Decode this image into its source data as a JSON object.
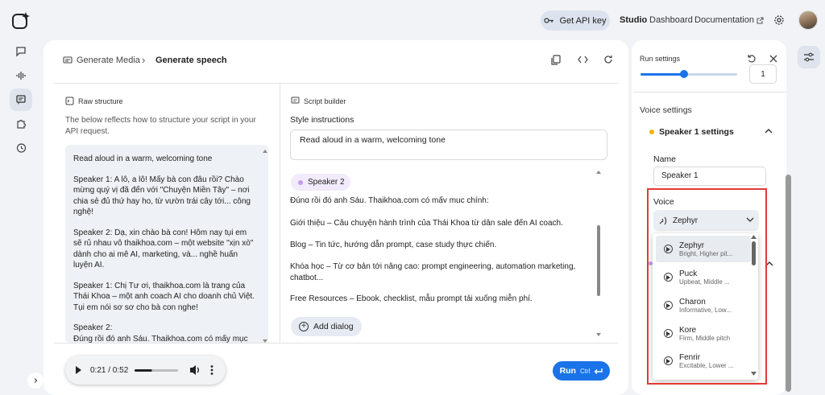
{
  "header": {
    "api_key_label": "Get API key",
    "nav_studio": "Studio",
    "nav_dashboard": "Dashboard",
    "nav_documentation": "Documentation"
  },
  "breadcrumb": {
    "parent": "Generate Media",
    "current": "Generate speech"
  },
  "raw_structure": {
    "title": "Raw structure",
    "description": "The below reflects how to structure your script in your API request.",
    "blocks": [
      "Read aloud in a warm, welcoming tone",
      "Speaker 1: A lô, a lô! Mấy bà con đâu rồi? Chào mừng quý vị đã đến với \"Chuyện Miền Tây\" – nơi chia sẻ đủ thứ hay ho, từ vườn trái cây tới... công nghệ!",
      "Speaker 2: Dạ, xin chào bà con! Hôm nay tụi em sẽ rủ nhau vô thaikhoa.com – một website \"xịn xò\" dành cho ai mê AI, marketing, và... nghề huấn luyện AI.",
      "Speaker 1: Chị Tư ơi, thaikhoa.com là trang của Thái Khoa – một anh coach AI cho doanh chủ Việt. Tụi em nói sơ sơ cho bà con nghe!",
      "Speaker 2:\nĐúng rồi đó anh Sáu. Thaikhoa.com có mấy mục"
    ]
  },
  "script_builder": {
    "title": "Script builder",
    "style_label": "Style instructions",
    "style_value": "Read aloud in a warm, welcoming tone",
    "speaker_chip": "Speaker 2",
    "lines": [
      "Đúng rồi đó anh Sáu. Thaikhoa.com có mấy mục chính:",
      "Giới thiệu – Câu chuyện hành trình của Thái Khoa từ dân sale đến AI coach.",
      "Blog – Tin tức, hướng dẫn prompt, case study thực chiến.",
      "Khóa học – Từ cơ bản tới nâng cao: prompt engineering, automation marketing, chatbot...",
      "Free Resources – Ebook, checklist, mẫu prompt tải xuống miễn phí."
    ],
    "add_dialog_label": "Add dialog"
  },
  "player": {
    "time": "0:21 / 0:52",
    "progress": 0.4
  },
  "run": {
    "label": "Run",
    "shortcut": "Ctrl"
  },
  "run_settings": {
    "title": "Run settings",
    "slider_value": 0.45,
    "number_value": "1"
  },
  "voice_settings": {
    "title": "Voice settings",
    "speaker1_title": "Speaker 1 settings",
    "name_label": "Name",
    "name_value": "Speaker 1",
    "voice_label": "Voice",
    "voice_selected": "Zephyr",
    "options": [
      {
        "name": "Zephyr",
        "desc": "Bright, Higher pit..."
      },
      {
        "name": "Puck",
        "desc": "Upbeat, Middle ..."
      },
      {
        "name": "Charon",
        "desc": "Informative, Low..."
      },
      {
        "name": "Kore",
        "desc": "Firm, Middle pitch"
      },
      {
        "name": "Fenrir",
        "desc": "Excitable, Lower ..."
      }
    ]
  },
  "colors": {
    "accent": "#1a73e8",
    "speaker1_dot": "#f4b400",
    "speaker2_dot": "#c39cf2",
    "highlight_box": "#e53935"
  },
  "icons": {
    "rail": [
      "new-chat-icon",
      "audio-wave-icon",
      "speech-icon",
      "puzzle-icon",
      "history-icon"
    ],
    "toolbar": [
      "copy-icon",
      "code-icon",
      "refresh-icon"
    ]
  }
}
